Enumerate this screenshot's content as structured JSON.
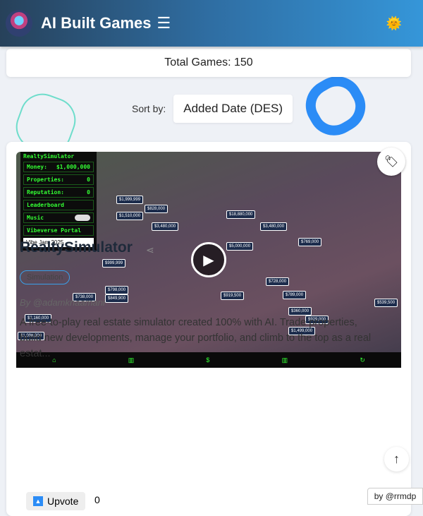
{
  "header": {
    "title": "AI Built Games",
    "menu_icon": "☰",
    "theme_icon": "🌞"
  },
  "total_games": "Total Games: 150",
  "sort": {
    "label": "Sort by:",
    "selected": "Added Date (DES)"
  },
  "game": {
    "title": "RealtySimulator",
    "genre": "Simulation",
    "author": "By @adamknaamani",
    "description": "A free-to-play real estate simulator created 100% with AI. Trade properties, build new developments, manage your portfolio, and climb to the top as a real estat...",
    "upvote_label": "Upvote",
    "upvote_count": "0",
    "thumbnail": {
      "hud_title": "RealtySimulator",
      "money_label": "Money:",
      "money": "$1,000,000",
      "properties_label": "Properties:",
      "properties": "0",
      "reputation_label": "Reputation:",
      "reputation": "0",
      "leaderboard": "Leaderboard",
      "music": "Music",
      "portal": "Vibeverse Portal",
      "jam": "Vibe Jam 2025",
      "prices": [
        "$1,999,999",
        "$828,000",
        "$1,510,000",
        "$3,480,000",
        "$18,880,000",
        "$3,480,000",
        "$769,000",
        "$5,000,000",
        "$999,999",
        "$919,500",
        "$728,000",
        "$738,000",
        "$798,000",
        "$849,900",
        "$789,000",
        "$360,000",
        "$929,000",
        "$539,500",
        "$1,499,000",
        "$2,160,000",
        "$1,098,000"
      ]
    }
  },
  "scroll_top_icon": "↑",
  "credit": "by @rrmdp"
}
